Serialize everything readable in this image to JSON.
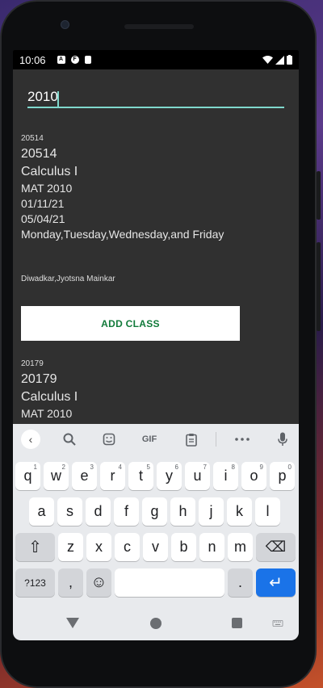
{
  "status_bar": {
    "time": "10:06",
    "icons": [
      "a-icon",
      "f-icon",
      "sim-icon"
    ],
    "right_icons": [
      "wifi-icon",
      "signal-icon",
      "battery-icon"
    ]
  },
  "search": {
    "value": "2010"
  },
  "courses": [
    {
      "crn_small": "20514",
      "crn": "20514",
      "title": "Calculus I",
      "course_code": "MAT 2010",
      "start_date": "01/11/21",
      "end_date": "05/04/21",
      "days": "Monday,Tuesday,Wednesday,and Friday",
      "instructor": "Diwadkar,Jyotsna Mainkar"
    },
    {
      "crn_small": "20179",
      "crn": "20179",
      "title": "Calculus I",
      "course_code": "MAT 2010"
    }
  ],
  "add_class_button": "ADD CLASS",
  "keyboard": {
    "toolbar": [
      "‹",
      "search",
      "sticker",
      "GIF",
      "clipboard",
      "more",
      "mic"
    ],
    "gif_label": "GIF",
    "row1": [
      {
        "k": "q",
        "s": "1"
      },
      {
        "k": "w",
        "s": "2"
      },
      {
        "k": "e",
        "s": "3"
      },
      {
        "k": "r",
        "s": "4"
      },
      {
        "k": "t",
        "s": "5"
      },
      {
        "k": "y",
        "s": "6"
      },
      {
        "k": "u",
        "s": "7"
      },
      {
        "k": "i",
        "s": "8"
      },
      {
        "k": "o",
        "s": "9"
      },
      {
        "k": "p",
        "s": "0"
      }
    ],
    "row2": [
      "a",
      "s",
      "d",
      "f",
      "g",
      "h",
      "j",
      "k",
      "l"
    ],
    "row3": [
      "z",
      "x",
      "c",
      "v",
      "b",
      "n",
      "m"
    ],
    "symbols_label": "?123",
    "comma": ",",
    "period": ".",
    "shift": "⇧",
    "backspace": "⌫",
    "emoji": "☺",
    "enter": "↵"
  },
  "nav": {
    "keyboard_icon": "keyboard-switch-icon"
  },
  "colors": {
    "screen_bg": "#303030",
    "accent": "#7fd8cd",
    "button_text": "#117a3a",
    "enter_key": "#1a73e8"
  }
}
